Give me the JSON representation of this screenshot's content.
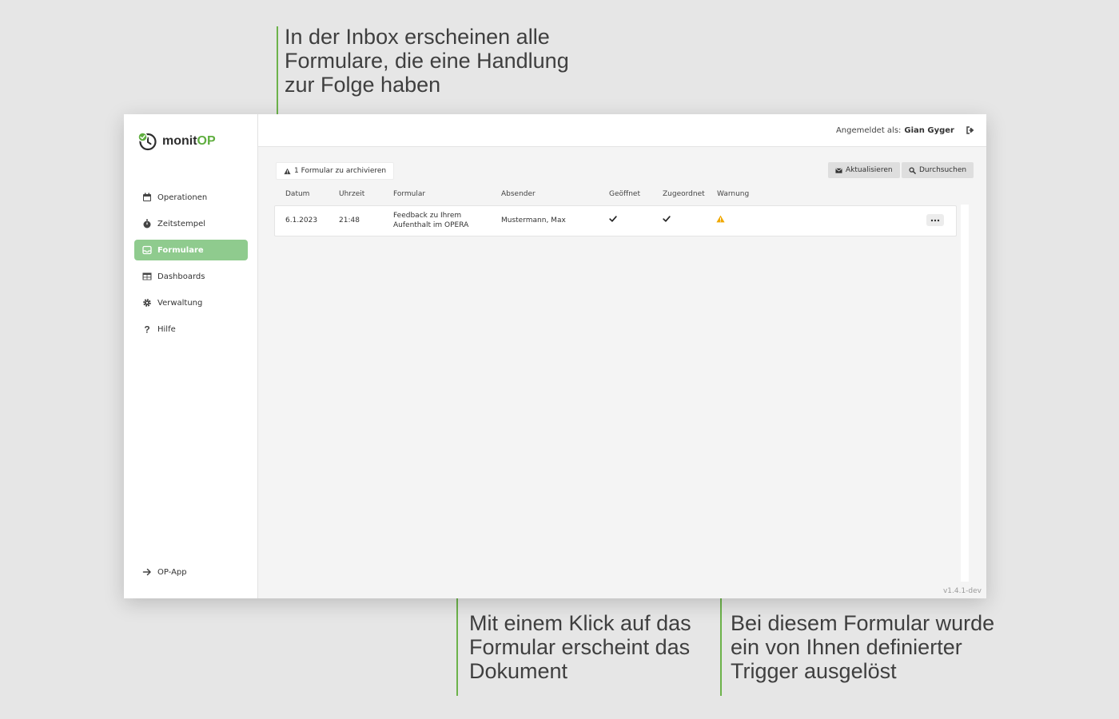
{
  "annotations": {
    "top": "In der Inbox erscheinen alle\nFormulare, die eine Handlung\nzur Folge haben",
    "middle": "Mit einem Klick auf das\nFormular erscheint das\nDokument",
    "right": "Bei diesem Formular wurde\nein von Ihnen definierter\nTrigger ausgelöst"
  },
  "app": {
    "logo": {
      "prefix": "monit",
      "accent": "OP"
    },
    "nav": [
      {
        "label": "Operationen",
        "icon": "calendar-icon"
      },
      {
        "label": "Zeitstempel",
        "icon": "stopwatch-icon"
      },
      {
        "label": "Formulare",
        "icon": "inbox-icon",
        "active": true
      },
      {
        "label": "Dashboards",
        "icon": "table-icon"
      },
      {
        "label": "Verwaltung",
        "icon": "gear-icon"
      },
      {
        "label": "Hilfe",
        "icon": "question-icon"
      }
    ],
    "nav_bottom": {
      "label": "OP-App",
      "icon": "arrow-right-icon"
    },
    "topbar": {
      "logged_in_label": "Angemeldet als:",
      "user": "Gian Gyger"
    },
    "toolbar": {
      "archive_label": "1 Formular zu archivieren",
      "refresh_label": "Aktualisieren",
      "search_label": "Durchsuchen"
    },
    "table": {
      "columns": [
        "Datum",
        "Uhrzeit",
        "Formular",
        "Absender",
        "Geöffnet",
        "Zugeordnet",
        "Warnung"
      ],
      "rows": [
        {
          "date": "6.1.2023",
          "time": "21:48",
          "form": "Feedback zu Ihrem Aufenthalt im OPERA",
          "sender": "Mustermann, Max",
          "opened": true,
          "assigned": true,
          "warning": true
        }
      ]
    },
    "version": "v1.4.1-dev",
    "colors": {
      "accent": "#5fae3f",
      "active_nav": "#8fcb8e",
      "annotation_line": "#6cb24a",
      "warning": "#f0a800"
    }
  }
}
